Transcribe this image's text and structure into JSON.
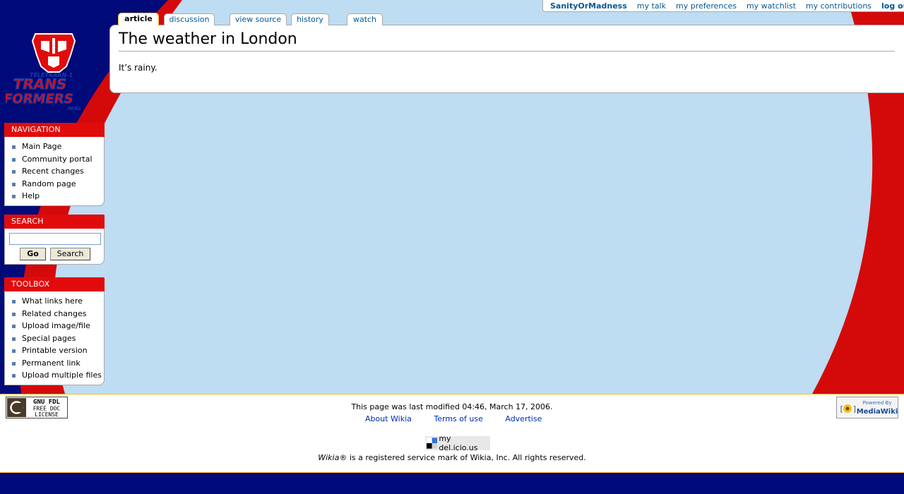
{
  "personal": {
    "username": "SanityOrMadness",
    "links": [
      "my talk",
      "my preferences",
      "my watchlist",
      "my contributions"
    ],
    "logout": "log out"
  },
  "tabs": {
    "article": "article",
    "discussion": "discussion",
    "view_source": "view source",
    "history": "history",
    "watch": "watch"
  },
  "article": {
    "title": "The weather in London",
    "body": "It’s rainy."
  },
  "logo": {
    "top_text": "TELETRAAN-1",
    "line1": "TRANS",
    "line2": "FORMERS",
    "line3": "WIKI"
  },
  "navigation": {
    "heading": "NAVIGATION",
    "items": [
      "Main Page",
      "Community portal",
      "Recent changes",
      "Random page",
      "Help"
    ]
  },
  "search": {
    "heading": "SEARCH",
    "value": "",
    "go_label": "Go",
    "search_label": "Search"
  },
  "toolbox": {
    "heading": "TOOLBOX",
    "items": [
      "What links here",
      "Related changes",
      "Upload image/file",
      "Special pages",
      "Printable version",
      "Permanent link",
      "Upload multiple files"
    ]
  },
  "footer": {
    "license_badge": [
      "GNU FDL",
      "FREE DOC",
      "LICENSE"
    ],
    "powered_badge": [
      "Powered By",
      "MediaWiki"
    ],
    "last_modified": "This page was last modified 04:46, March 17, 2006.",
    "links": [
      "About Wikia",
      "Terms of use",
      "Advertise"
    ],
    "delicious": "my del.icio.us",
    "wikia_brand": "Wikia",
    "wikia_notice": "® is a registered service mark of Wikia, Inc. All rights reserved."
  },
  "colors": {
    "navy": "#000a78",
    "red": "#e10b0b",
    "light_blue": "#bedcf2",
    "link": "#005896",
    "gold_border": "#fabd23"
  }
}
